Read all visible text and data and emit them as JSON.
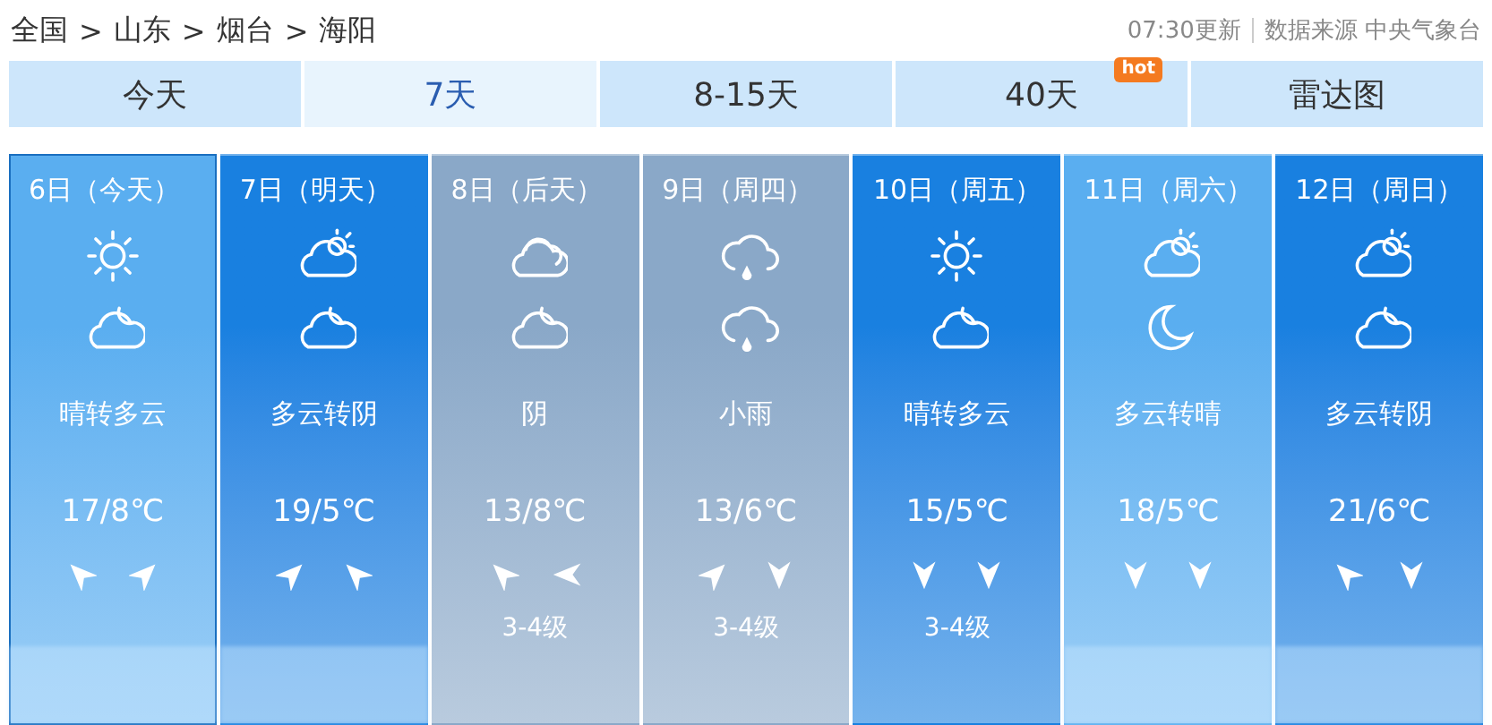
{
  "breadcrumb": [
    {
      "label": "全国"
    },
    {
      "label": "山东"
    },
    {
      "label": "烟台"
    },
    {
      "label": "海阳"
    }
  ],
  "separator": ">",
  "update_time": "07:30更新",
  "source": "数据来源 中央气象台",
  "tabs": [
    {
      "label": "今天",
      "selected": false
    },
    {
      "label": "7天",
      "selected": true
    },
    {
      "label": "8-15天",
      "selected": false
    },
    {
      "label": "40天",
      "selected": false,
      "badge": "hot"
    },
    {
      "label": "雷达图",
      "selected": false
    }
  ],
  "days": [
    {
      "date": "6日（今天）",
      "selected": true,
      "color": "#5aaef0",
      "day_icon": {
        "kind": "sun"
      },
      "night_icon": {
        "kind": "cloudmoon"
      },
      "weather": "晴转多云",
      "temp": "17/8℃",
      "wind": [
        {
          "kind": "nw"
        },
        {
          "kind": "ne"
        }
      ],
      "blurred": true
    },
    {
      "date": "7日（明天）",
      "selected": false,
      "color": "#1980e0",
      "day_icon": {
        "kind": "cloudsun"
      },
      "night_icon": {
        "kind": "cloudmoon"
      },
      "weather": "多云转阴",
      "temp": "19/5℃",
      "wind": [
        {
          "kind": "ne"
        },
        {
          "kind": "nw"
        }
      ],
      "blurred": true
    },
    {
      "date": "8日（后天）",
      "selected": false,
      "color": "#8aa8c8",
      "day_icon": {
        "kind": "cloud"
      },
      "night_icon": {
        "kind": "cloudmoon"
      },
      "weather": "阴",
      "temp": "13/8℃",
      "wind": [
        {
          "kind": "nw"
        },
        {
          "kind": "w"
        }
      ],
      "blurred": false,
      "level": "3-4级"
    },
    {
      "date": "9日（周四）",
      "selected": false,
      "color": "#8aa8c8",
      "day_icon": {
        "kind": "rain"
      },
      "night_icon": {
        "kind": "rain"
      },
      "weather": "小雨",
      "temp": "13/6℃",
      "wind": [
        {
          "kind": "ne"
        },
        {
          "kind": "s"
        }
      ],
      "blurred": false,
      "level": "3-4级"
    },
    {
      "date": "10日（周五）",
      "selected": false,
      "color": "#1980e0",
      "day_icon": {
        "kind": "sun"
      },
      "night_icon": {
        "kind": "cloudmoon"
      },
      "weather": "晴转多云",
      "temp": "15/5℃",
      "wind": [
        {
          "kind": "s"
        },
        {
          "kind": "s"
        }
      ],
      "blurred": false,
      "level": "3-4级"
    },
    {
      "date": "11日（周六）",
      "selected": false,
      "color": "#5aaef0",
      "day_icon": {
        "kind": "cloudsun"
      },
      "night_icon": {
        "kind": "moon"
      },
      "weather": "多云转晴",
      "temp": "18/5℃",
      "wind": [
        {
          "kind": "s"
        },
        {
          "kind": "s"
        }
      ],
      "blurred": true
    },
    {
      "date": "12日（周日）",
      "selected": false,
      "color": "#1980e0",
      "day_icon": {
        "kind": "cloudsun"
      },
      "night_icon": {
        "kind": "cloudmoon"
      },
      "weather": "多云转阴",
      "temp": "21/6℃",
      "wind": [
        {
          "kind": "nw"
        },
        {
          "kind": "s"
        }
      ],
      "blurred": true
    }
  ]
}
